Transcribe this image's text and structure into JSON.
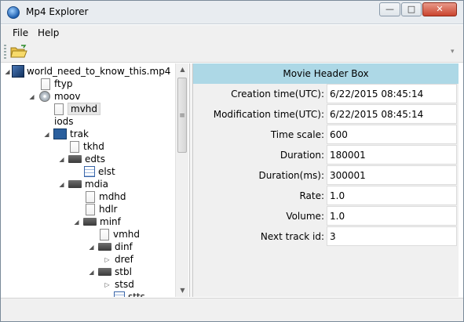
{
  "window": {
    "title": "Mp4 Explorer",
    "minimize": "—",
    "maximize": "□",
    "close": "✕"
  },
  "menu": {
    "file": "File",
    "help": "Help"
  },
  "tree": {
    "root": "world_need_to_know_this.mp4",
    "ftyp": "ftyp",
    "moov": "moov",
    "mvhd": "mvhd",
    "iods": "iods",
    "trak": "trak",
    "tkhd": "tkhd",
    "edts": "edts",
    "elst": "elst",
    "mdia": "mdia",
    "mdhd": "mdhd",
    "hdlr": "hdlr",
    "minf": "minf",
    "vmhd": "vmhd",
    "dinf": "dinf",
    "dref": "dref",
    "stbl": "stbl",
    "stsd": "stsd",
    "stts": "stts"
  },
  "panel": {
    "header": "Movie Header Box",
    "rows": [
      {
        "label": "Creation time(UTC):",
        "value": "6/22/2015 08:45:14"
      },
      {
        "label": "Modification time(UTC):",
        "value": "6/22/2015 08:45:14"
      },
      {
        "label": "Time scale:",
        "value": "600"
      },
      {
        "label": "Duration:",
        "value": "180001"
      },
      {
        "label": "Duration(ms):",
        "value": "300001"
      },
      {
        "label": "Rate:",
        "value": "1.0"
      },
      {
        "label": "Volume:",
        "value": "1.0"
      },
      {
        "label": "Next track id:",
        "value": "3"
      }
    ]
  },
  "colors": {
    "panel_header": "#add8e6",
    "chrome": "#f0f0f0"
  }
}
